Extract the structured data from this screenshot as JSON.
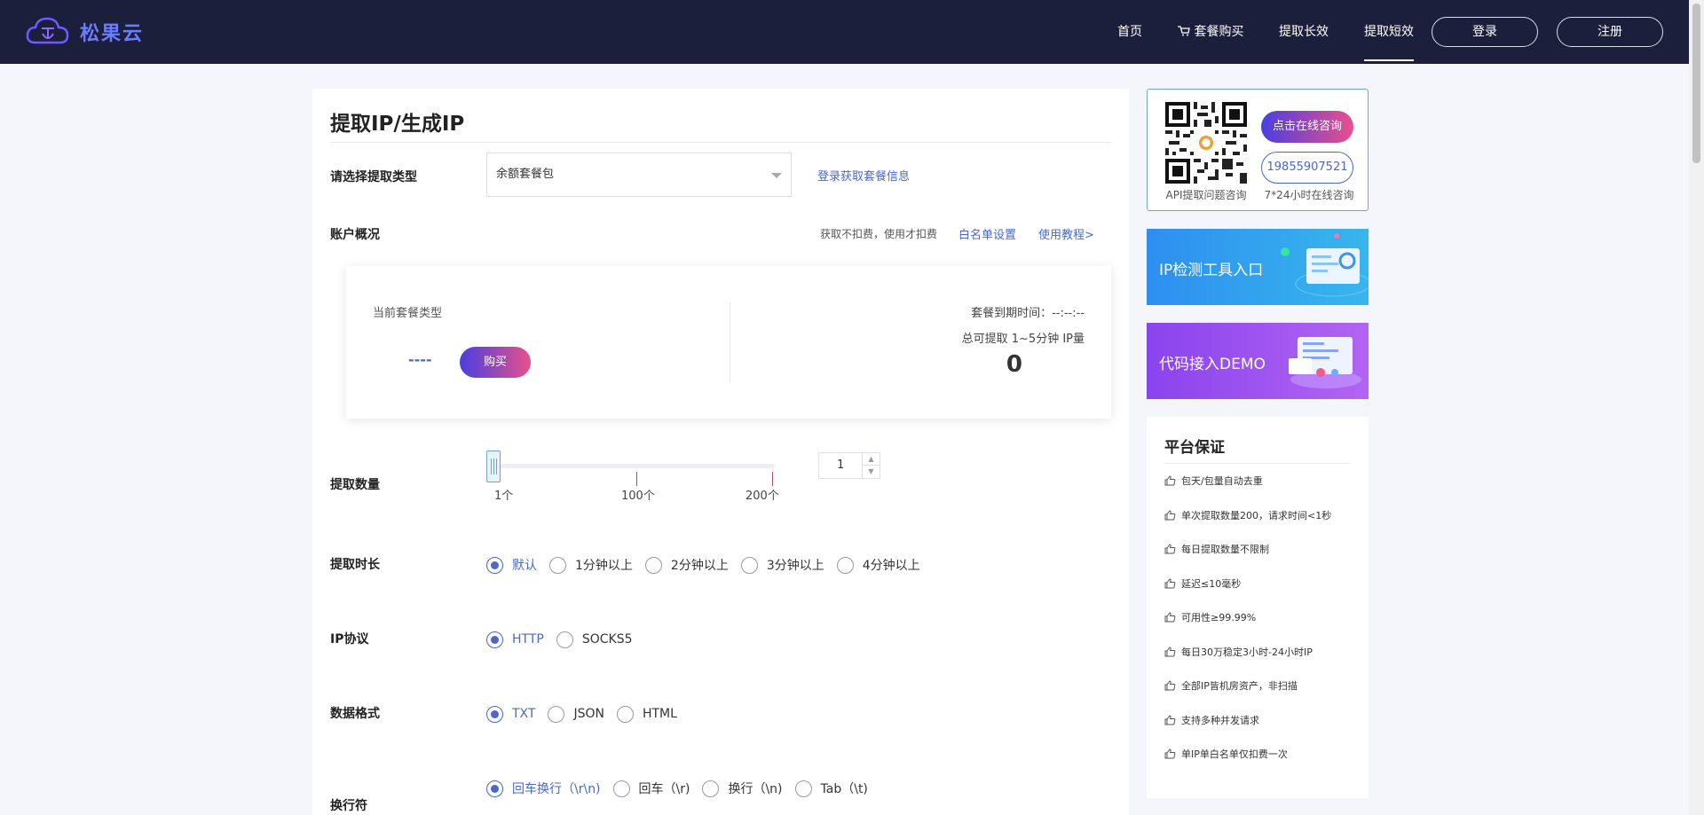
{
  "header": {
    "logo_text": "松果云",
    "nav": {
      "home": "首页",
      "package": "套餐购买",
      "long": "提取长效",
      "short": "提取短效"
    },
    "login": "登录",
    "register": "注册"
  },
  "main": {
    "title": "提取IP/生成IP",
    "type_label": "请选择提取类型",
    "type_value": "余额套餐包",
    "login_link": "登录获取套餐信息",
    "account_label": "账户概况",
    "billing_hint": "获取不扣费，使用才扣费",
    "whitelist_link": "白名单设置",
    "tutorial_link": "使用教程>",
    "card": {
      "current_label": "当前套餐类型",
      "current_value": "----",
      "buy": "购买",
      "expire": "套餐到期时间：--:--:--",
      "total_label": "总可提取 1~5分钟 IP量",
      "total_value": "0"
    },
    "quantity": {
      "label": "提取数量",
      "value": 1,
      "min": 1,
      "max": 200,
      "marks": [
        "1个",
        "100个",
        "200个"
      ],
      "stepper_value": "1"
    },
    "duration": {
      "label": "提取时长",
      "options": [
        "默认",
        "1分钟以上",
        "2分钟以上",
        "3分钟以上",
        "4分钟以上"
      ],
      "selected": "默认"
    },
    "protocol": {
      "label": "IP协议",
      "options": [
        "HTTP",
        "SOCKS5"
      ],
      "selected": "HTTP"
    },
    "format": {
      "label": "数据格式",
      "options": [
        "TXT",
        "JSON",
        "HTML"
      ],
      "selected": "TXT"
    },
    "newline": {
      "label": "换行符",
      "options": [
        "回车换行（\\r\\n)",
        "回车（\\r)",
        "换行（\\n)",
        "Tab（\\t)"
      ],
      "selected": "回车换行（\\r\\n)"
    }
  },
  "sidebar": {
    "contact": {
      "qr_caption": "API提取问题咨询",
      "consult_button": "点击在线咨询",
      "phone": "19855907521",
      "hours": "7*24小时在线咨询"
    },
    "banner_ip_check": "IP检测工具入口",
    "banner_demo": "代码接入DEMO",
    "guarantee": {
      "title": "平台保证",
      "items": [
        "包天/包量自动去重",
        "单次提取数量200，请求时间<1秒",
        "每日提取数量不限制",
        "延迟≤10毫秒",
        "可用性≥99.99%",
        "每日30万稳定3小时-24小时IP",
        "全部IP皆机房资产，非扫描",
        "支持多种并发请求",
        "单IP单白名单仅扣费一次"
      ]
    }
  },
  "colors": {
    "header_bg": "#1c1f3b",
    "accent": "#4a68c9",
    "button_gradient_start": "#4a3fe0",
    "button_gradient_end": "#e8508a"
  }
}
